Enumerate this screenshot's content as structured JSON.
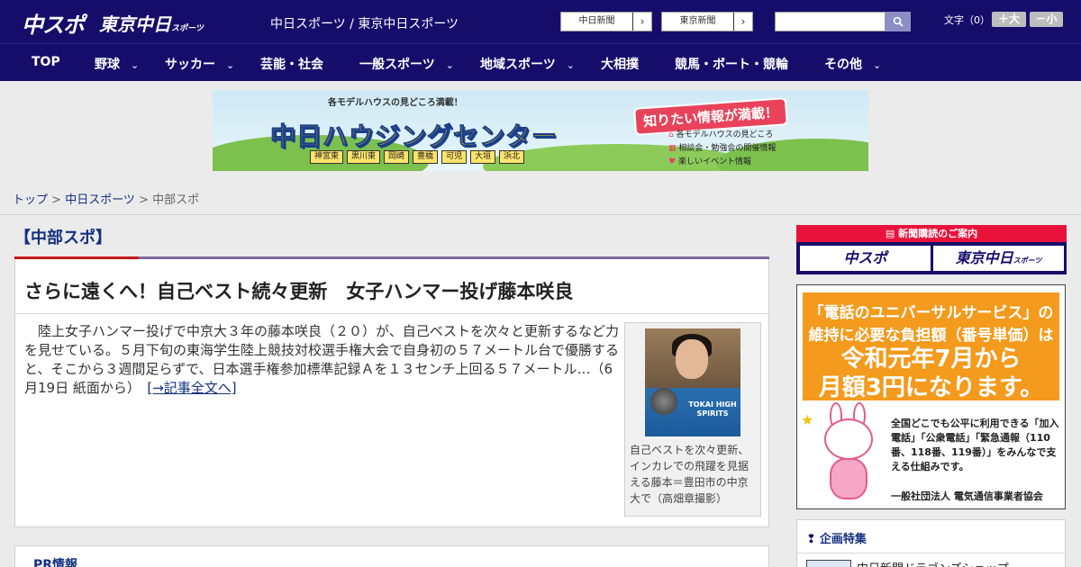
{
  "header": {
    "logo_chunichi": "中スポ",
    "logo_tokyo": "東京中日",
    "logo_tokyo_suffix": "スポーツ",
    "site_name": "中日スポーツ / 東京中日スポーツ",
    "paper_links": [
      {
        "label": "中日新聞",
        "arrow": "›"
      },
      {
        "label": "東京新聞",
        "arrow": "›"
      }
    ],
    "search": {
      "placeholder": "",
      "icon": "search-icon"
    },
    "text_size_label": "文字（0）",
    "size_up": "＋大",
    "size_down": "－小"
  },
  "nav": {
    "items": [
      {
        "label": "TOP",
        "dropdown": ""
      },
      {
        "label": "野球",
        "dropdown": "⌄"
      },
      {
        "label": "サッカー",
        "dropdown": "⌄"
      },
      {
        "label": "芸能・社会",
        "dropdown": ""
      },
      {
        "label": "一般スポーツ",
        "dropdown": "⌄"
      },
      {
        "label": "地域スポーツ",
        "dropdown": "⌄"
      },
      {
        "label": "大相撲",
        "dropdown": ""
      },
      {
        "label": "競馬・ボート・競輪",
        "dropdown": ""
      },
      {
        "label": "その他",
        "dropdown": "⌄"
      }
    ]
  },
  "banner": {
    "top_text": "各モデルハウスの見どころ満載！",
    "title": "中日ハウジングセンター",
    "badge": "知りたい情報が満載！",
    "areas": [
      "神宮東",
      "黒川東",
      "岡崎",
      "豊橋",
      "可児",
      "大垣",
      "浜北"
    ],
    "info": [
      "各モデルハウスの見どころ",
      "相談会・勉強会の開催情報",
      "楽しいイベント情報"
    ]
  },
  "breadcrumb": {
    "home": "トップ",
    "sep1": " > ",
    "section": "中日スポーツ",
    "sep2": " > ",
    "current": "中部スポ"
  },
  "main": {
    "section_title": "【中部スポ】",
    "article": {
      "headline": "さらに遠くへ！自己ベスト続々更新　女子ハンマー投げ藤本咲良",
      "body": "陸上女子ハンマー投げで中京大３年の藤本咲良（２０）が、自己ベストを次々と更新するなど力を見せている。５月下旬の東海学生陸上競技対校選手権大会で自身初の５７メートル台で優勝すると、そこから３週間足らずで、日本選手権参加標準記録Ａを１３センチ上回る５７メートル…（6月19日 紙面から）　",
      "more_link": "[→記事全文へ]",
      "photo_shirt": "TOKAI HIGH SPIRITS",
      "caption": "自己ベストを次々更新、インカレでの飛躍を見据える藤本＝豊田市の中京大で（高畑章撮影）"
    },
    "pr_title": "PR情報"
  },
  "sidebar": {
    "subscribe": {
      "head": "新聞購読のご案内",
      "chunichi": "中スポ",
      "tokyo": "東京中日",
      "tokyo_suffix": "スポーツ"
    },
    "ad": {
      "line1": "「電話のユニバーサルサービス」の",
      "line2": "維持に必要な負担額（番号単価）は",
      "line3": "令和元年7月から",
      "line4": "月額3円になります。",
      "text": "全国どこでも公平に利用できる「加入電話」「公衆電話」「緊急通報（110番、118番、119番）」をみんなで支える仕組みです。",
      "org": "一般社団法人 電気通信事業者協会"
    },
    "feature": {
      "title": "企画特集",
      "item": "中日新聞ドラゴンズショップ"
    }
  },
  "colors": {
    "header_bg": "#160d6b",
    "link": "#13317f",
    "accent_red": "#c8161d",
    "subscribe_red": "#e8123a",
    "ad_orange": "#f49a1c"
  }
}
